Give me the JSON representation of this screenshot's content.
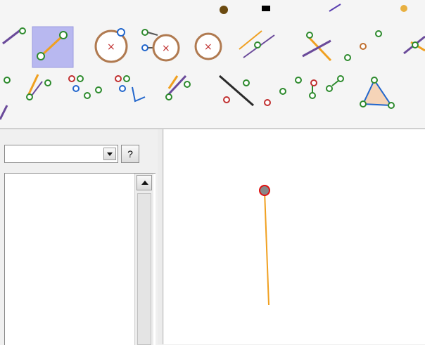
{
  "toolbar": {
    "tools": [
      {
        "icon": "segment-tool-icon",
        "selected": false
      },
      {
        "icon": "segment-between-points-icon",
        "selected": true
      },
      {
        "icon": "circle-with-center-icon",
        "selected": false
      },
      {
        "icon": "compass-circle-icon",
        "selected": false
      },
      {
        "icon": "circle-center-icon",
        "selected": false
      },
      {
        "icon": "parallel-line-icon",
        "selected": false
      },
      {
        "icon": "perpendicular-line-icon",
        "selected": false
      },
      {
        "icon": "collinear-points-icon",
        "selected": false
      },
      {
        "icon": "angle-bisector-icon",
        "selected": false
      },
      {
        "icon": "ray-tool-icon",
        "selected": false
      },
      {
        "icon": "line-through-points-icon",
        "selected": false
      },
      {
        "icon": "point-on-object-icon",
        "selected": false
      },
      {
        "icon": "vector-tool-icon",
        "selected": false
      },
      {
        "icon": "line-tool-icon",
        "selected": false
      },
      {
        "icon": "intersection-tool-icon",
        "selected": false
      },
      {
        "icon": "midpoint-tool-icon",
        "selected": false
      },
      {
        "icon": "locus-tool-icon",
        "selected": false
      },
      {
        "icon": "triangle-polygon-icon",
        "selected": false
      }
    ]
  },
  "left_panel": {
    "combo_value": "",
    "help_label": "?"
  },
  "colors": {
    "segment": "#f0a020",
    "point_fill": "#888888",
    "point_stroke": "#e01010",
    "selected_tool_bg": "#b8b8f0"
  },
  "canvas": {
    "objects": [
      {
        "type": "segment",
        "name": "segment-icon",
        "color": "#f0a020"
      },
      {
        "type": "point",
        "name": "point",
        "fill": "#888888",
        "stroke": "#e01010"
      }
    ]
  }
}
